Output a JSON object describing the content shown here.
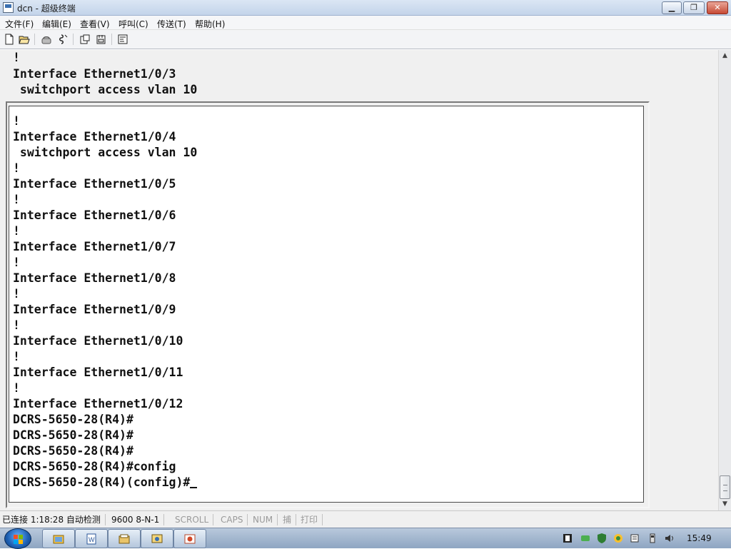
{
  "window": {
    "title": "dcn - 超级终端",
    "buttons": {
      "minimize": "▁",
      "maximize": "❐",
      "close": "✕"
    }
  },
  "menu": [
    "文件(F)",
    "编辑(E)",
    "查看(V)",
    "呼叫(C)",
    "传送(T)",
    "帮助(H)"
  ],
  "toolbar": {
    "icons": [
      "new-document-icon",
      "open-folder-icon",
      "dial-phone-icon",
      "disconnect-icon",
      "send-file-icon",
      "receive-file-icon",
      "properties-icon"
    ]
  },
  "terminal": {
    "outer_lines": [
      "!",
      "Interface Ethernet1/0/3",
      " switchport access vlan 10"
    ],
    "lines": [
      "!",
      "Interface Ethernet1/0/4",
      " switchport access vlan 10",
      "!",
      "Interface Ethernet1/0/5",
      "!",
      "Interface Ethernet1/0/6",
      "!",
      "Interface Ethernet1/0/7",
      "!",
      "Interface Ethernet1/0/8",
      "!",
      "Interface Ethernet1/0/9",
      "!",
      "Interface Ethernet1/0/10",
      "!",
      "Interface Ethernet1/0/11",
      "!",
      "Interface Ethernet1/0/12",
      "DCRS-5650-28(R4)#",
      "DCRS-5650-28(R4)#",
      "DCRS-5650-28(R4)#",
      "DCRS-5650-28(R4)#config"
    ],
    "prompt": "DCRS-5650-28(R4)(config)#"
  },
  "status": {
    "connection": "已连接 1:18:28 自动检测",
    "port_settings": "9600 8-N-1",
    "scroll": "SCROLL",
    "caps": "CAPS",
    "num": "NUM",
    "capture": "捕",
    "print": "打印"
  },
  "taskbar": {
    "clock": "15:49"
  }
}
